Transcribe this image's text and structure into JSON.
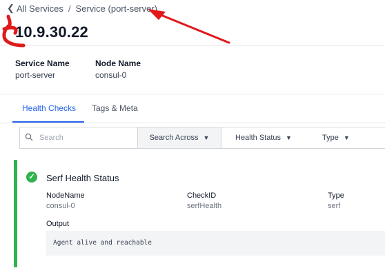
{
  "breadcrumb": {
    "back_label": "All Services",
    "separator": "/",
    "current": "Service (port-server)"
  },
  "page_title": "10.9.30.22",
  "meta": {
    "service_name_label": "Service Name",
    "service_name_value": "port-server",
    "node_name_label": "Node Name",
    "node_name_value": "consul-0"
  },
  "tabs": [
    {
      "label": "Health Checks",
      "active": true
    },
    {
      "label": "Tags & Meta",
      "active": false
    }
  ],
  "toolbar": {
    "search_placeholder": "Search",
    "search_across_label": "Search Across",
    "health_status_label": "Health Status",
    "type_label": "Type"
  },
  "check": {
    "title": "Serf Health Status",
    "status": "passing",
    "node_name_label": "NodeName",
    "node_name_value": "consul-0",
    "check_id_label": "CheckID",
    "check_id_value": "serfHealth",
    "type_label": "Type",
    "type_value": "serf",
    "output_label": "Output",
    "output_value": "Agent alive and reachable"
  },
  "colors": {
    "accent": "#2563eb",
    "passing": "#2fb34e",
    "annotation": "#e0191b"
  }
}
